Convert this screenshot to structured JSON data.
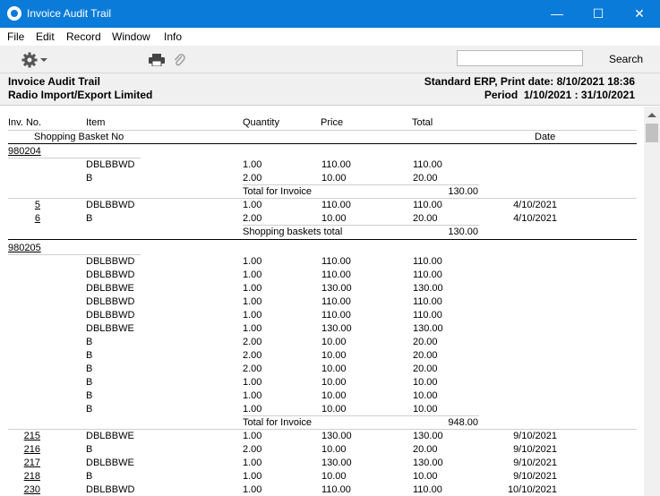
{
  "window": {
    "title": "Invoice Audit Trail",
    "minimize": "—",
    "maximize": "☐",
    "close": "✕"
  },
  "menu": [
    "File",
    "Edit",
    "Record",
    "Window",
    "Info"
  ],
  "toolbar": {
    "search_label": "Search",
    "search_value": ""
  },
  "report_header": {
    "left1": "Invoice Audit Trail",
    "left2": "Radio Import/Export Limited",
    "right1": "Standard ERP, Print date: 8/10/2021 18:36",
    "right2": "Period  1/10/2021 : 31/10/2021"
  },
  "columns": {
    "inv_no": "Inv. No.",
    "item": "Item",
    "quantity": "Quantity",
    "price": "Price",
    "total": "Total",
    "basket": "Shopping Basket No",
    "date": "Date"
  },
  "groups": [
    {
      "basket": "980204",
      "lines": [
        [
          "DBLBBWD",
          "1.00",
          "110.00",
          "110.00"
        ],
        [
          "B",
          "2.00",
          "10.00",
          "20.00"
        ]
      ],
      "invoice_total_label": "Total for Invoice",
      "invoice_total": "130.00",
      "invoices": [
        [
          "5",
          "DBLBBWD",
          "1.00",
          "110.00",
          "110.00",
          "4/10/2021"
        ],
        [
          "6",
          "B",
          "2.00",
          "10.00",
          "20.00",
          "4/10/2021"
        ]
      ],
      "basket_total_label": "Shopping baskets total",
      "basket_total": "130.00"
    },
    {
      "basket": "980205",
      "lines": [
        [
          "DBLBBWD",
          "1.00",
          "110.00",
          "110.00"
        ],
        [
          "DBLBBWD",
          "1.00",
          "110.00",
          "110.00"
        ],
        [
          "DBLBBWE",
          "1.00",
          "130.00",
          "130.00"
        ],
        [
          "DBLBBWD",
          "1.00",
          "110.00",
          "110.00"
        ],
        [
          "DBLBBWD",
          "1.00",
          "110.00",
          "110.00"
        ],
        [
          "DBLBBWE",
          "1.00",
          "130.00",
          "130.00"
        ],
        [
          "B",
          "2.00",
          "10.00",
          "20.00"
        ],
        [
          "B",
          "2.00",
          "10.00",
          "20.00"
        ],
        [
          "B",
          "2.00",
          "10.00",
          "20.00"
        ],
        [
          "B",
          "1.00",
          "10.00",
          "10.00"
        ],
        [
          "B",
          "1.00",
          "10.00",
          "10.00"
        ],
        [
          "B",
          "1.00",
          "10.00",
          "10.00"
        ]
      ],
      "invoice_total_label": "Total for Invoice",
      "invoice_total": "948.00",
      "invoices": [
        [
          "215",
          "DBLBBWE",
          "1.00",
          "130.00",
          "130.00",
          "9/10/2021"
        ],
        [
          "216",
          "B",
          "2.00",
          "10.00",
          "20.00",
          "9/10/2021"
        ],
        [
          "217",
          "DBLBBWE",
          "1.00",
          "130.00",
          "130.00",
          "9/10/2021"
        ],
        [
          "218",
          "B",
          "1.00",
          "10.00",
          "10.00",
          "9/10/2021"
        ],
        [
          "230",
          "DBLBBWD",
          "1.00",
          "110.00",
          "110.00",
          "10/10/2021"
        ]
      ]
    }
  ]
}
